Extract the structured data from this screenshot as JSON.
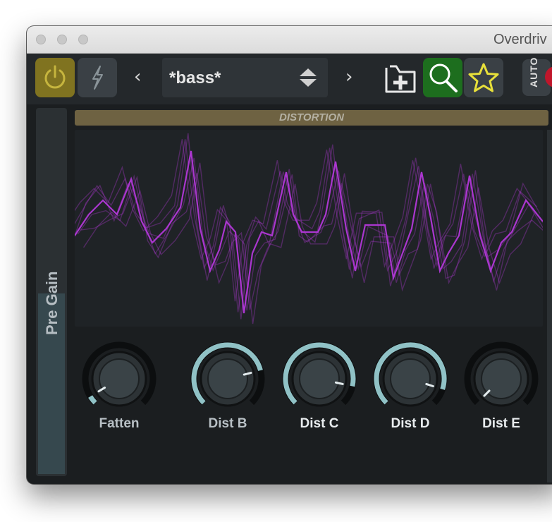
{
  "window": {
    "title": "Overdriv"
  },
  "toolbar": {
    "preset_name": "*bass*",
    "prev_arrow": "‹",
    "next_arrow": "›",
    "auto_label": "AUTO"
  },
  "panel": {
    "section_title": "DISTORTION",
    "pre_gain_label": "Pre Gain",
    "pre_gain_level": 0.5
  },
  "knobs": [
    {
      "label": "Fatten",
      "value": 0.05,
      "label_color": "#b8c0c5"
    },
    {
      "label": "Dist B",
      "value": 0.78,
      "label_color": "#b8c0c5"
    },
    {
      "label": "Dist C",
      "value": 0.88,
      "label_color": "#e8ecee"
    },
    {
      "label": "Dist D",
      "value": 0.9,
      "label_color": "#e8ecee"
    },
    {
      "label": "Dist E",
      "value": 0.0,
      "label_color": "#e8ecee"
    }
  ],
  "colors": {
    "power_active": "#807320",
    "search_active": "#1d6e1e",
    "waveform": "#b238d8",
    "knob_arc": "#9fd6da",
    "record": "#c0162b"
  }
}
